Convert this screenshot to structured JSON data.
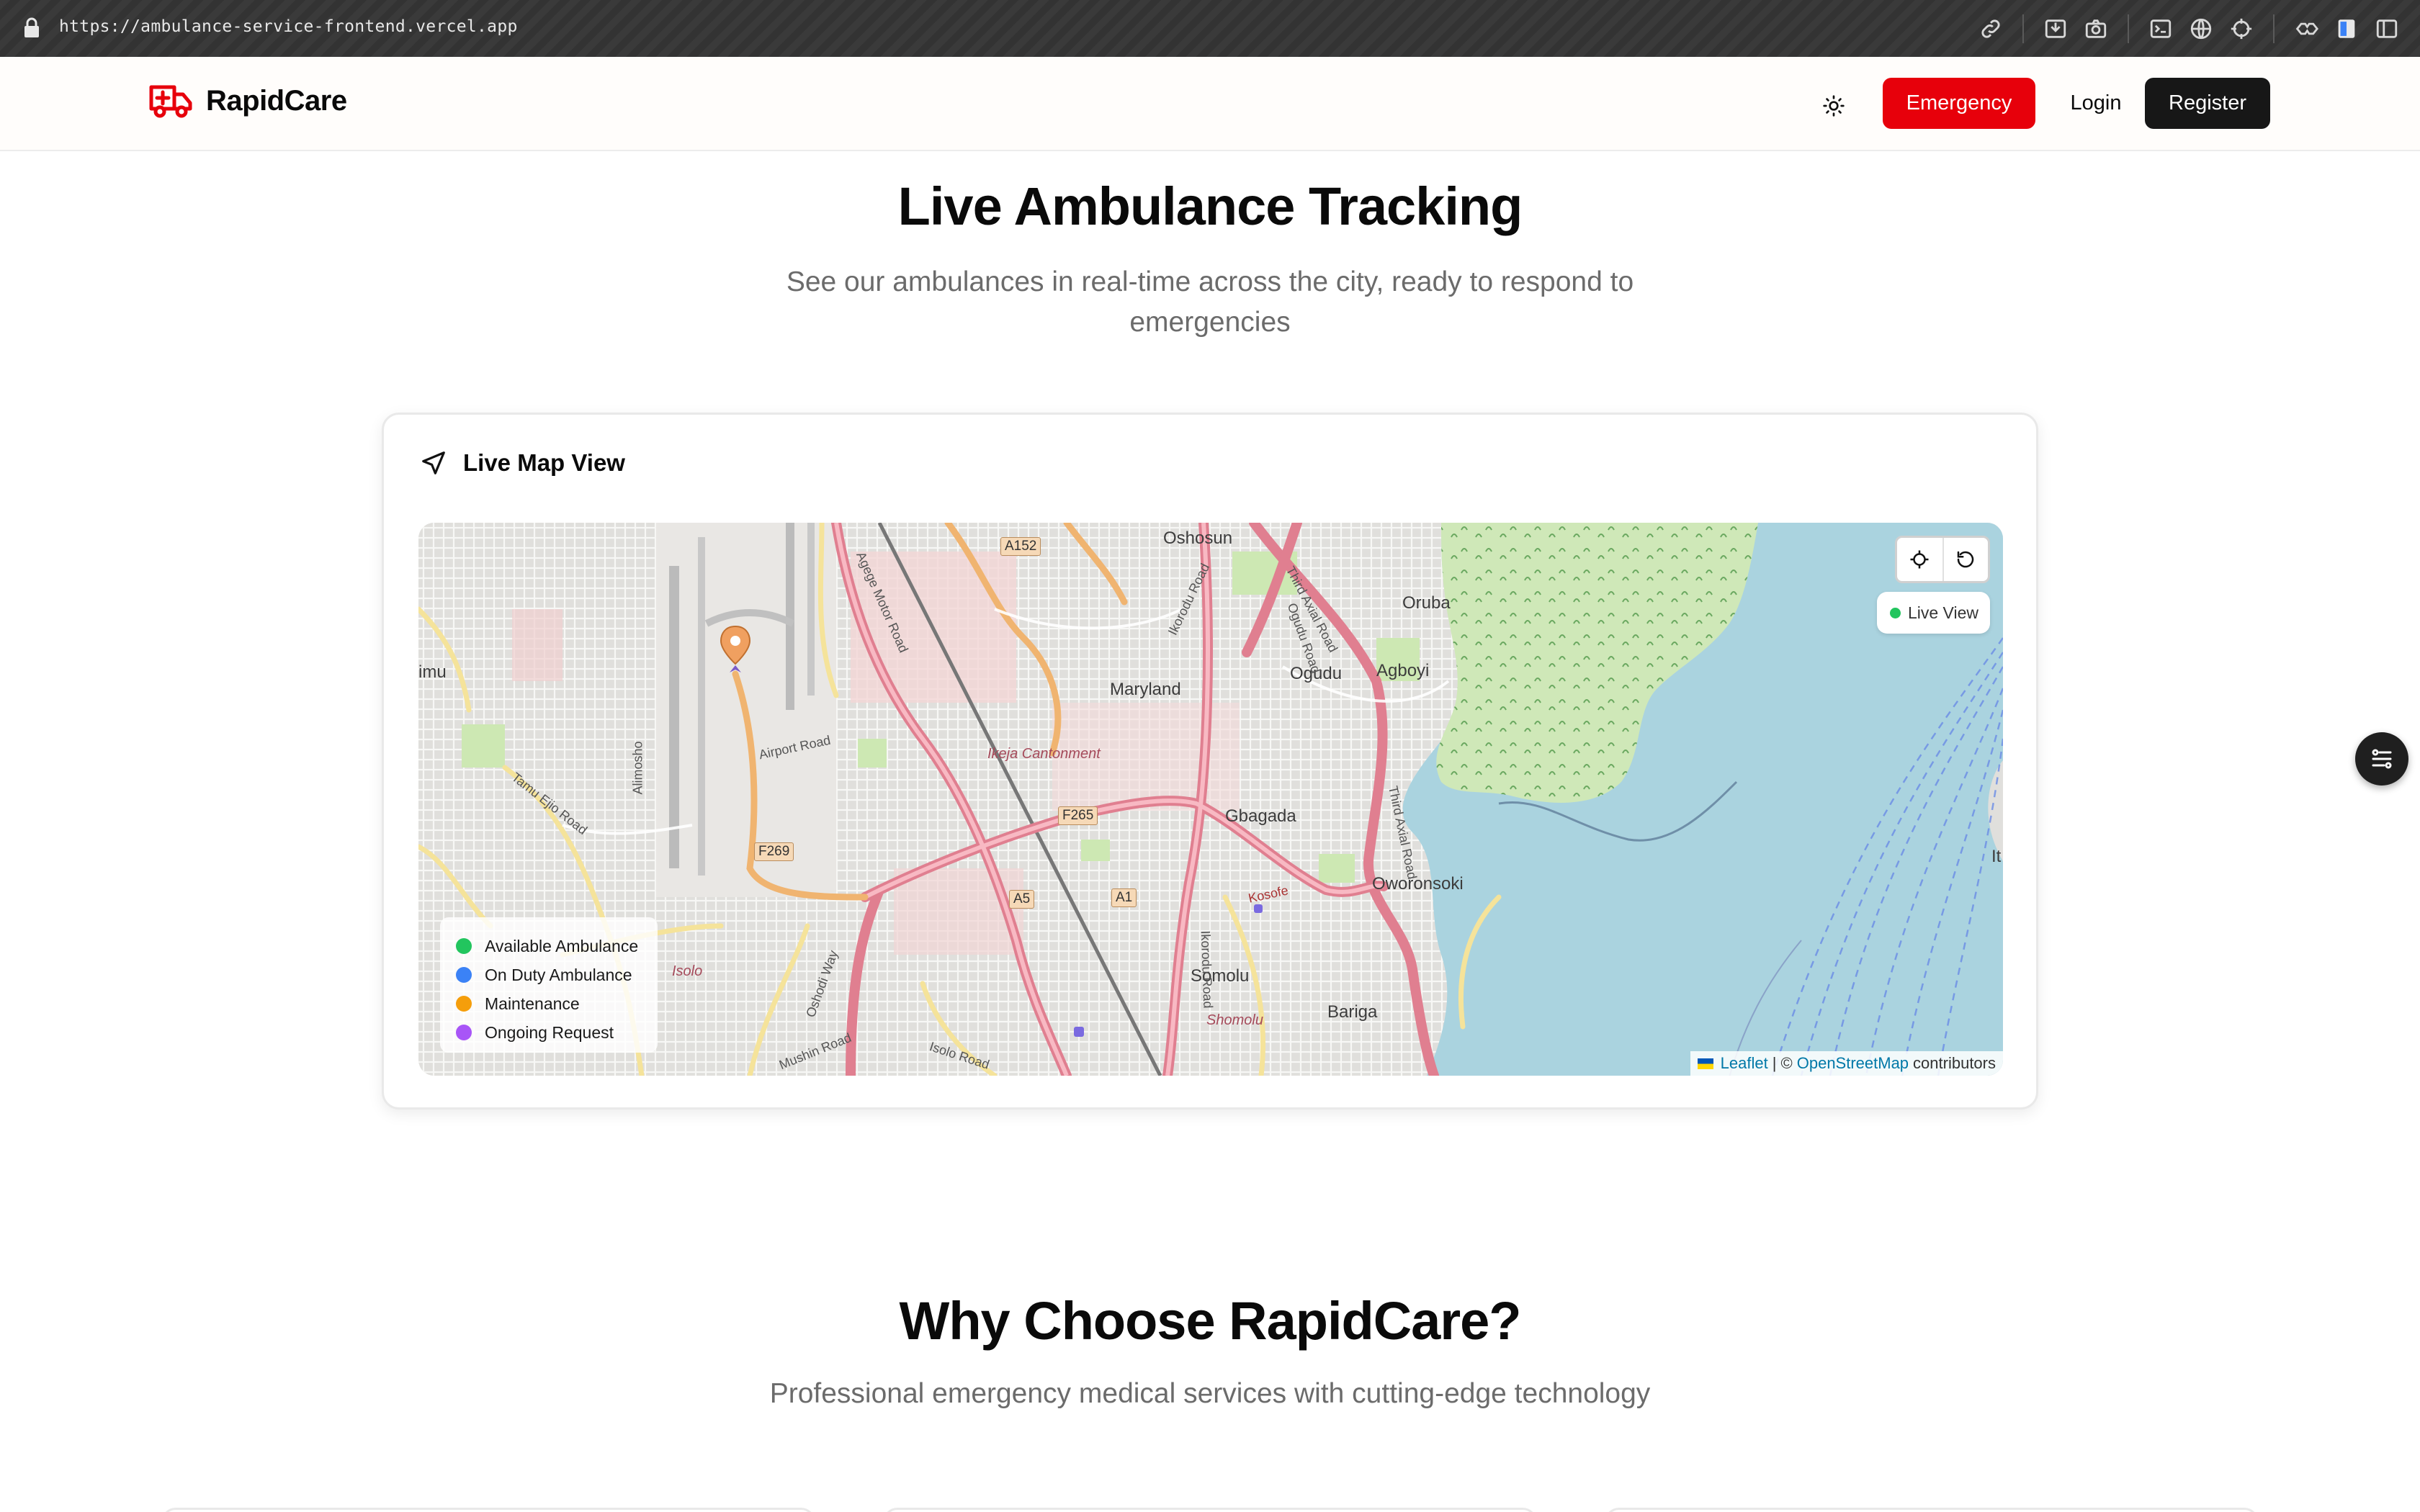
{
  "browser": {
    "url": "https://ambulance-service-frontend.vercel.app",
    "icons": [
      "link-icon",
      "download-icon",
      "camera-icon",
      "terminal-icon",
      "globe-icon",
      "crosshair-icon",
      "extensions-icon",
      "sidebar-icon",
      "split-view-icon"
    ]
  },
  "header": {
    "brand_name": "RapidCare",
    "emergency_label": "Emergency",
    "login_label": "Login",
    "register_label": "Register",
    "brand_color": "#e7000b"
  },
  "tracking": {
    "title": "Live Ambulance Tracking",
    "subtitle": "See our ambulances in real-time across the city, ready to respond to emergencies",
    "card_title": "Live Map View",
    "live_badge": "Live View",
    "legend": [
      {
        "label": "Available Ambulance",
        "color": "#22c55e"
      },
      {
        "label": "On Duty Ambulance",
        "color": "#3b82f6"
      },
      {
        "label": "Maintenance",
        "color": "#f59e0b"
      },
      {
        "label": "Ongoing Request",
        "color": "#a855f7"
      }
    ],
    "attribution": {
      "leaflet": "Leaflet",
      "separator": "| ©",
      "osm": "OpenStreetMap",
      "suffix": "contributors"
    },
    "map_labels": {
      "oshosun": "Oshosun",
      "oruba": "Oruba",
      "maryland": "Maryland",
      "ogudu": "Ogudu",
      "agboyi": "Agboyi",
      "ikeja_cantonment": "Ikeja Cantonment",
      "gbagada": "Gbagada",
      "oworonsoki": "Oworonsoki",
      "somolu": "Somolu",
      "shomolu": "Shomolu",
      "bariga": "Bariga",
      "isolo": "Isolo",
      "imu": "imu",
      "it": "It",
      "airport_road": "Airport Road",
      "alimosho": "Alimosho",
      "ijesha_road": "Tamu Ejio Road",
      "oshodi_road": "Oshodi Way",
      "mushin_road": "Mushin Road",
      "isolo_road": "Isolo Road",
      "kosofe": "Kosofe",
      "third_axial_1": "Third Axial Road",
      "third_axial_2": "Third Axial Road",
      "ikorodu_road_1": "Ikorodu Road",
      "ikorodu_road_2": "Ikorodu Road",
      "ogudu_road": "Ogudu Road",
      "agege_road": "Agege Motor Road"
    },
    "road_shields": {
      "a152": "A152",
      "f265": "F265",
      "f269": "F269",
      "a5": "A5",
      "a1": "A1"
    }
  },
  "features": {
    "title": "Why Choose RapidCare?",
    "subtitle": "Professional emergency medical services with cutting-edge technology"
  }
}
